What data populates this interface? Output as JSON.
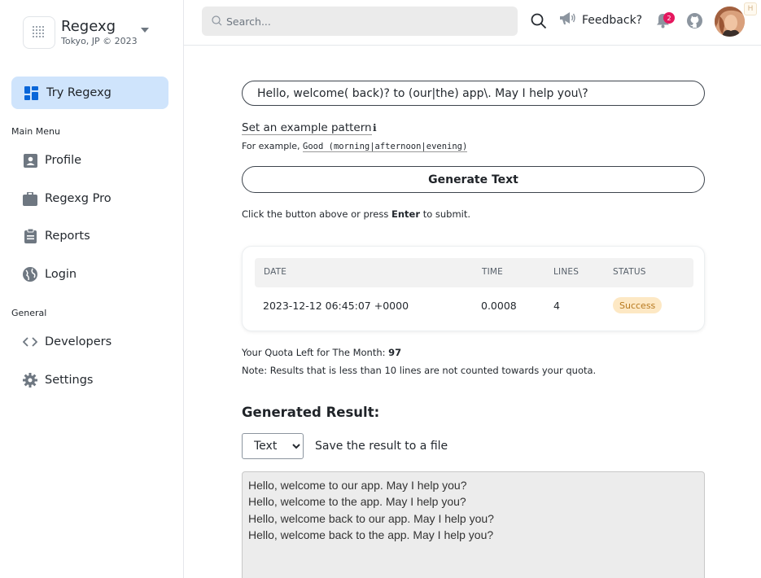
{
  "brand": {
    "name": "Regexg",
    "subtitle": "Tokyo, JP © 2023"
  },
  "sidebar": {
    "active_item": {
      "label": "Try Regexg",
      "icon": "dashboard-icon"
    },
    "sections": [
      {
        "title": "Main Menu",
        "items": [
          {
            "label": "Profile",
            "icon": "profile-card-icon"
          },
          {
            "label": "Regexg Pro",
            "icon": "briefcase-icon"
          },
          {
            "label": "Reports",
            "icon": "clipboard-icon"
          },
          {
            "label": "Login",
            "icon": "globe-icon"
          }
        ]
      },
      {
        "title": "General",
        "items": [
          {
            "label": "Developers",
            "icon": "code-icon"
          },
          {
            "label": "Settings",
            "icon": "gear-icon"
          }
        ]
      }
    ]
  },
  "topbar": {
    "search_placeholder": "Search...",
    "feedback_label": "Feedback?",
    "notification_count": "2",
    "avatar_tag": "H"
  },
  "main": {
    "pattern_value": "Hello, welcome( back)? to (our|the) app\\. May I help you\\?",
    "example_link": "Set an example pattern",
    "info_glyph": "ℹ",
    "example_prefix": "For example,",
    "example_code": "Good (morning|afternoon|evening)",
    "generate_button": "Generate Text",
    "hint_before": "Click the button above or press",
    "hint_key": "Enter",
    "hint_after": "to submit.",
    "table": {
      "headers": [
        "DATE",
        "TIME",
        "LINES",
        "STATUS"
      ],
      "rows": [
        {
          "date": "2023-12-12 06:45:07 +0000",
          "time": "0.0008",
          "lines": "4",
          "status": "Success"
        }
      ]
    },
    "quota_label": "Your Quota Left for The Month:",
    "quota_value": "97",
    "note": "Note: Results that is less than 10 lines are not counted towards your quota.",
    "result_title": "Generated Result:",
    "format_options": [
      "Text"
    ],
    "format_selected": "Text",
    "save_label": "Save the result to a file",
    "result_lines": [
      "Hello, welcome to our app. May I help you?",
      "Hello, welcome to the app. May I help you?",
      "Hello, welcome back to our app. May I help you?",
      "Hello, welcome back to the app. May I help you?"
    ]
  },
  "colors": {
    "active_nav_bg": "#cfe4fc",
    "accent_blue": "#0a66d8",
    "badge_red": "#e5175e",
    "success_bg": "#fde8c4",
    "success_text": "#b7791f"
  }
}
